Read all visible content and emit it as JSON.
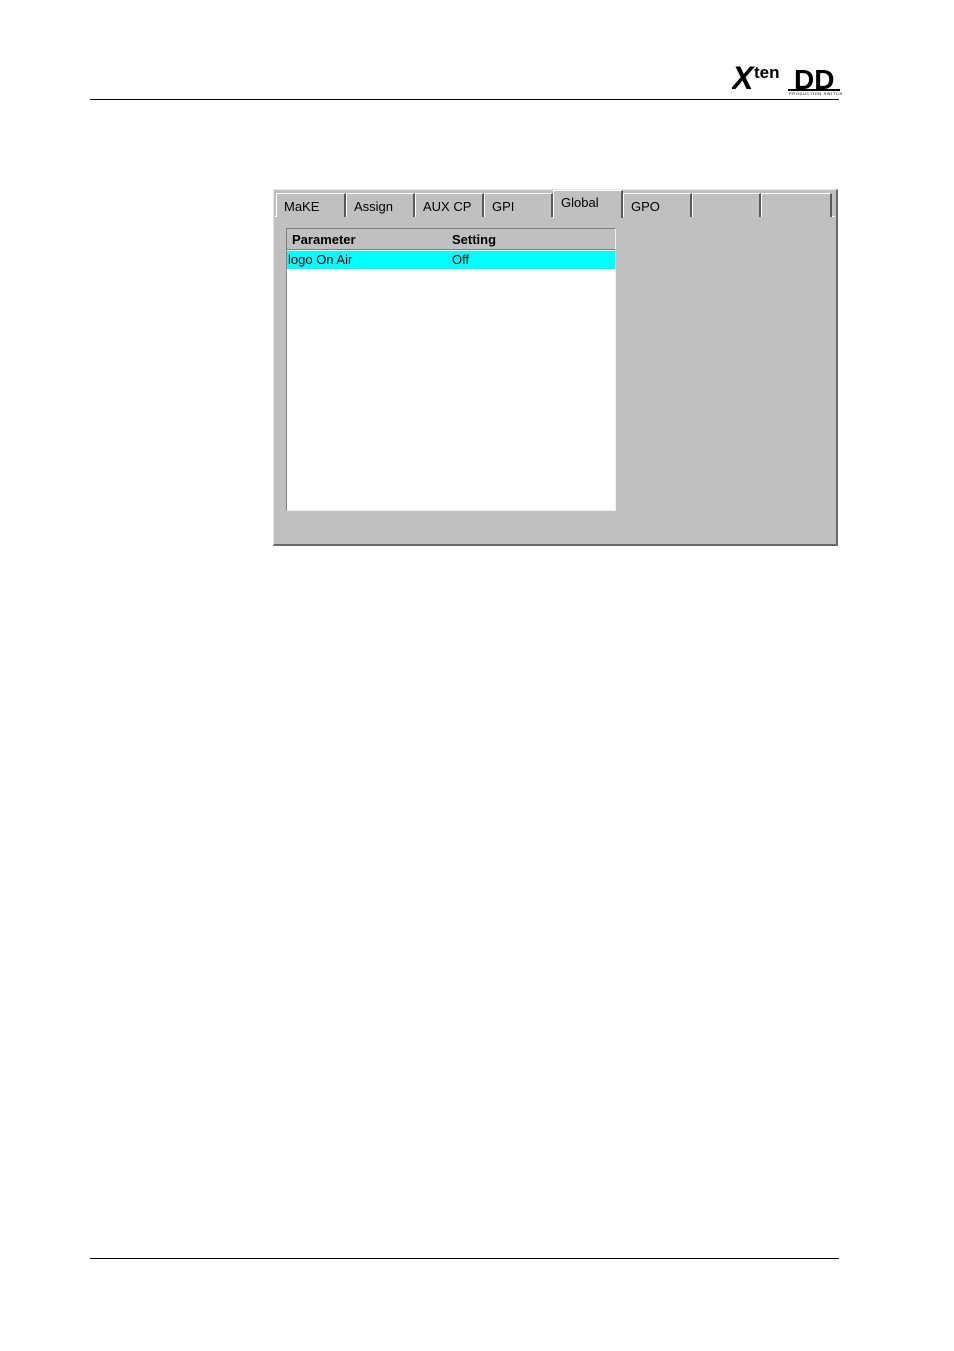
{
  "header": {
    "logo_text": "Xten DD",
    "logo_tagline": "PRODUCTION SWITCHERS"
  },
  "tabs": [
    {
      "label": "MaKE",
      "active": false
    },
    {
      "label": "Assign",
      "active": false
    },
    {
      "label": "AUX CP",
      "active": false
    },
    {
      "label": "GPI",
      "active": false
    },
    {
      "label": "Global",
      "active": true
    },
    {
      "label": "GPO",
      "active": false
    },
    {
      "label": "",
      "active": false
    },
    {
      "label": "",
      "active": false
    }
  ],
  "table": {
    "columns": [
      "Parameter",
      "Setting"
    ],
    "rows": [
      {
        "parameter": "logo On Air",
        "setting": "Off",
        "selected": true
      }
    ]
  },
  "colors": {
    "panel_bg": "#c0c0c0",
    "selected_row": "#00ffff"
  }
}
